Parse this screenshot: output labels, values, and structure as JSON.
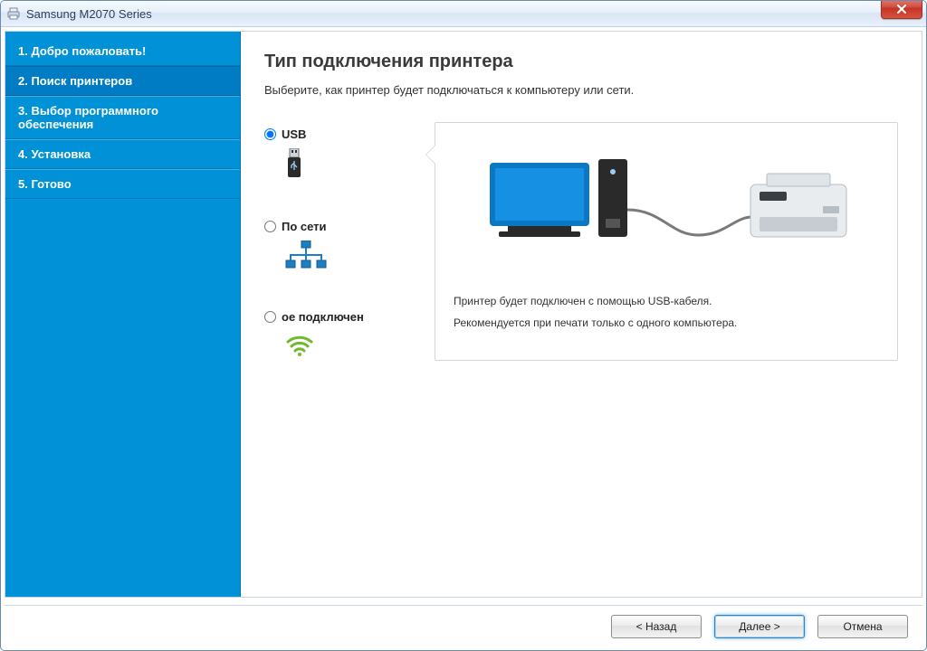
{
  "window": {
    "title": "Samsung M2070 Series"
  },
  "sidebar": {
    "steps": [
      {
        "label": "1. Добро пожаловать!",
        "active": false
      },
      {
        "label": "2. Поиск принтеров",
        "active": true
      },
      {
        "label": "3. Выбор программного обеспечения",
        "active": false
      },
      {
        "label": "4. Установка",
        "active": false
      },
      {
        "label": "5. Готово",
        "active": false
      }
    ]
  },
  "main": {
    "heading": "Тип подключения принтера",
    "subtitle": "Выберите, как принтер будет подключаться к компьютеру или сети."
  },
  "options": {
    "usb": {
      "label": "USB",
      "selected": true
    },
    "network": {
      "label": "По сети",
      "selected": false
    },
    "wireless": {
      "label": "ое подключен",
      "selected": false
    }
  },
  "panel": {
    "desc1": "Принтер будет подключен с помощью USB-кабеля.",
    "desc2": "Рекомендуется при печати только с одного компьютера."
  },
  "footer": {
    "back": "< Назад",
    "next": "Далее >",
    "cancel": "Отмена"
  },
  "icons": {
    "titlebar": "printer-icon",
    "close": "close-icon",
    "usb": "usb-device-icon",
    "network": "network-topology-icon",
    "wireless": "wifi-icon"
  }
}
